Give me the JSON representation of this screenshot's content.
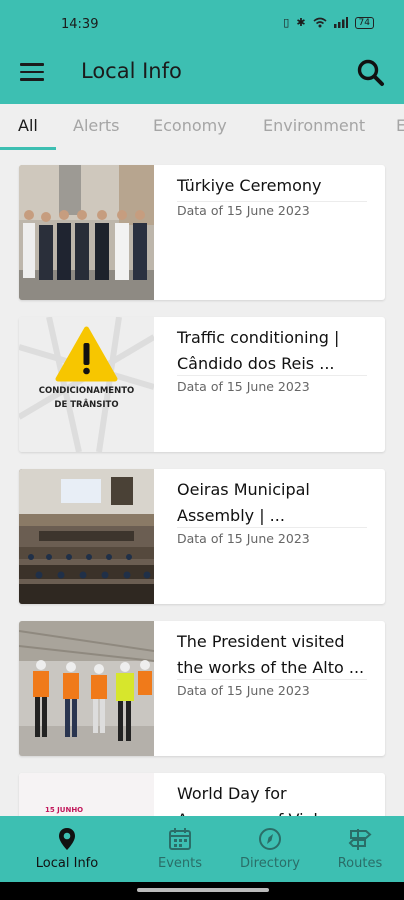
{
  "status": {
    "time": "14:39",
    "battery": "74"
  },
  "app_bar": {
    "title": "Local Info",
    "menu_icon": "hamburger-menu-icon",
    "search_icon": "search-icon"
  },
  "tabs": [
    {
      "label": "All",
      "active": true
    },
    {
      "label": "Alerts"
    },
    {
      "label": "Economy"
    },
    {
      "label": "Environment"
    },
    {
      "label": "E"
    }
  ],
  "news": [
    {
      "title": "Türkiye Ceremony",
      "date": "Data of 15 June 2023",
      "image": "ceremony-photo"
    },
    {
      "title": "Traffic conditioning | Cândido dos Reis ...",
      "date": "Data of 15 June 2023",
      "image": "traffic-warning-graphic",
      "image_text": [
        "CONDICIONAMENTO",
        "DE TRÂNSITO"
      ]
    },
    {
      "title": "Oeiras Municipal Assembly | ...",
      "date": "Data of 15 June 2023",
      "image": "assembly-photo"
    },
    {
      "title": "The President visited the works of the Alto ...",
      "date": "Data of 15 June 2023",
      "image": "site-visit-photo"
    },
    {
      "title": "World Day for Awareness of Violence ...",
      "date": "",
      "image": "awareness-poster",
      "image_text": [
        "15 JUNHO"
      ]
    }
  ],
  "bottom_nav": [
    {
      "label": "Local Info",
      "icon": "location-pin-icon",
      "active": true
    },
    {
      "label": "Events",
      "icon": "calendar-icon"
    },
    {
      "label": "Directory",
      "icon": "compass-icon"
    },
    {
      "label": "Routes",
      "icon": "signpost-icon"
    }
  ],
  "colors": {
    "accent": "#3dbfb2",
    "background": "#efefef",
    "active_text": "#111111",
    "inactive_tab": "#a5a5a5"
  }
}
